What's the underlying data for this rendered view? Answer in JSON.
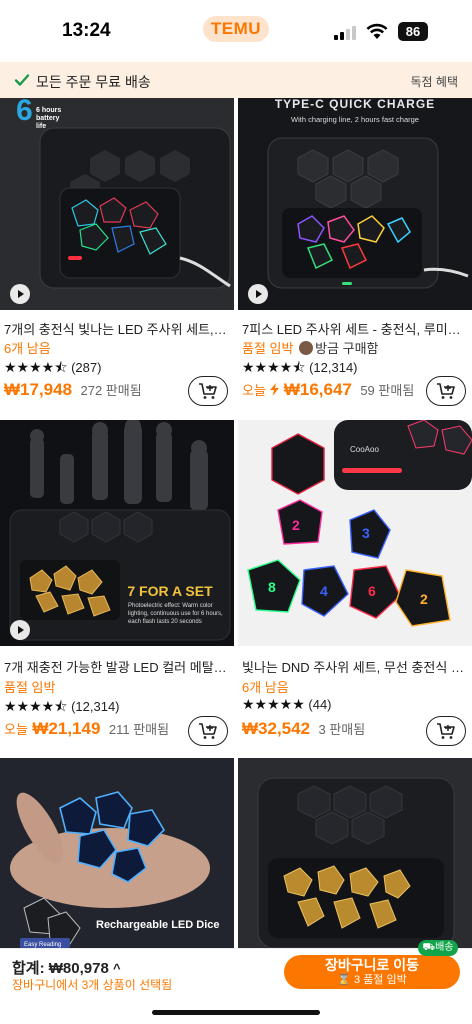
{
  "status_bar": {
    "time": "13:24",
    "app_badge": "TEMU",
    "battery": "86"
  },
  "ship_banner": {
    "message": "모든 주문 무료 배송",
    "right_label": "독점 혜택"
  },
  "products": [
    {
      "title": "7개의 충전식 빛나는 LED 주사위 세트, 충전식",
      "sub": "6개 남음",
      "stars": "★★★★⯪",
      "reviews": "(287)",
      "price": "₩17,948",
      "sold": "272 판매됨",
      "image_text": [
        "6 hours",
        "battery",
        "life"
      ],
      "has_video": true
    },
    {
      "title": "7피스 LED 주사위 세트 - 충전식, 루미너스",
      "sub": "품절 임박",
      "sub_extra": "방금 구매함",
      "stars": "★★★★⯪",
      "reviews": "(12,314)",
      "price_prefix": "오늘",
      "price": "₩16,647",
      "sold": "59 판매됨",
      "image_text": [
        "TYPE-C QUICK CHARGE",
        "With charging line, 2 hours fast charge"
      ],
      "has_video": true
    },
    {
      "title": "7개 재충전 가능한 발광 LED 컬러 메탈 주사위",
      "sub": "품절 임박",
      "stars": "★★★★⯪",
      "reviews": "(12,314)",
      "price_prefix": "오늘",
      "price": "₩21,149",
      "sold": "211 판매됨",
      "image_text": [
        "7 FOR A SET",
        "Photoelectric effect: Warm color lighting, continuous use for 6 hours, each flash lasts 20 seconds"
      ],
      "has_video": true
    },
    {
      "title": "빛나는 DND 주사위 세트, 무선 충전식 LED 주사위",
      "sub": "6개 남음",
      "stars": "★★★★★",
      "reviews": "(44)",
      "price": "₩32,542",
      "sold": "3 판매됨",
      "image_text": [
        "CooAoo"
      ],
      "has_video": false
    },
    {
      "image_text": [
        "Rechargeable LED Dice",
        "Easy Reading"
      ]
    },
    {
      "image_text": []
    }
  ],
  "cart_bar": {
    "total_label": "합계: ₩80,978",
    "total_chevron": "^",
    "note": "장바구니에서 3개 상품이 선택됨",
    "checkout_label": "장바구니로 이동",
    "checkout_sub": "⌛ 3 품절 임박",
    "ship_badge": "배송"
  },
  "colors": {
    "accent": "#fb7701",
    "green": "#11a44a"
  }
}
